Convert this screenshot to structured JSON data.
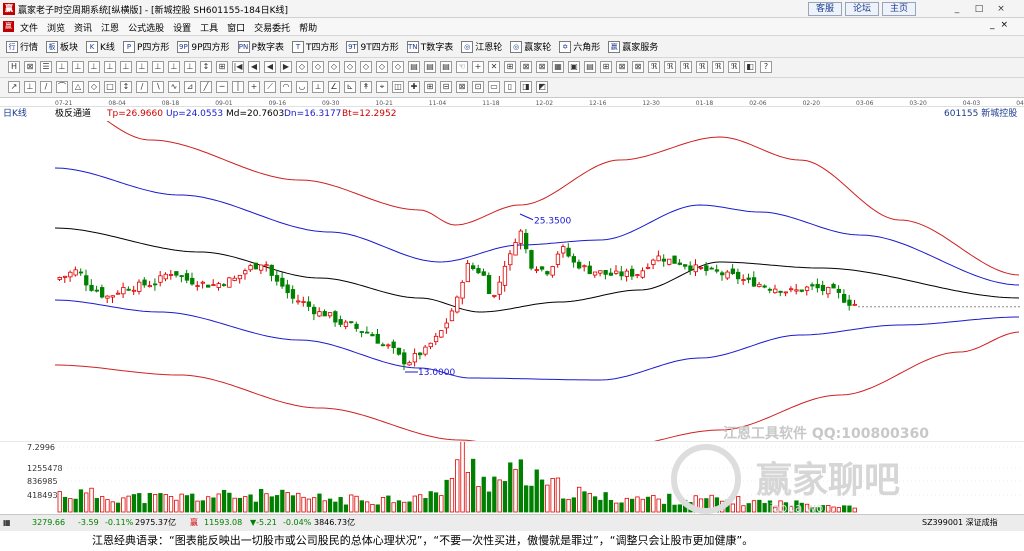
{
  "window": {
    "title": "赢家老子时空周期系统[纵横版] - [新城控股  SH601155-184日K线]",
    "app_icon_text": "赢",
    "link_buttons": [
      "客服",
      "论坛",
      "主页"
    ],
    "controls": [
      "_",
      "□",
      "×"
    ]
  },
  "menu": {
    "icon_text": "赢",
    "items": [
      "文件",
      "浏览",
      "资讯",
      "江恩",
      "公式选股",
      "设置",
      "工具",
      "窗口",
      "交易委托",
      "帮助"
    ],
    "right_controls": [
      "_",
      "×"
    ]
  },
  "toolbar1": {
    "items": [
      {
        "glyph": "行",
        "label": "行情"
      },
      {
        "glyph": "板",
        "label": "板块"
      },
      {
        "glyph": "K",
        "label": "K线"
      },
      {
        "glyph": "P",
        "label": "P四方形"
      },
      {
        "glyph": "9P",
        "label": "9P四方形"
      },
      {
        "glyph": "PN",
        "label": "P数字表"
      },
      {
        "glyph": "T",
        "label": "T四方形"
      },
      {
        "glyph": "9T",
        "label": "9T四方形"
      },
      {
        "glyph": "TN",
        "label": "T数字表"
      },
      {
        "glyph": "◎",
        "label": "江恩轮"
      },
      {
        "glyph": "◎",
        "label": "赢家轮"
      },
      {
        "glyph": "✡",
        "label": "六角形"
      },
      {
        "glyph": "赢",
        "label": "赢家服务"
      }
    ]
  },
  "toolbar2": {
    "icons": [
      "H",
      "⊠",
      "☰",
      "⊥",
      "⊥",
      "⊥",
      "⊥",
      "⊥",
      "⊥",
      "⊥",
      "⊥",
      "⊥",
      "↕",
      "⊞",
      "|◀",
      "◀",
      "◀",
      "▶",
      "◇",
      "◇",
      "◇",
      "◇",
      "◇",
      "◇",
      "◇",
      "▤",
      "▤",
      "▤",
      "☜",
      "+",
      "✕",
      "⊞",
      "⊠",
      "⊠",
      "▦",
      "▣",
      "▤",
      "⊞",
      "⊠",
      "⊠",
      "ℜ",
      "ℜ",
      "ℜ",
      "ℜ",
      "ℜ",
      "ℜ",
      "◧",
      "?"
    ]
  },
  "toolbar3": {
    "icons": [
      "↗",
      "⊥",
      "/",
      "⌒",
      "△",
      "◇",
      "□",
      "↕",
      "∕",
      "∖",
      "∿",
      "⊿",
      "╱",
      "─",
      "│",
      "+",
      "⟋",
      "◠",
      "◡",
      "⟂",
      "∠",
      "⊾",
      "↟",
      "⌖",
      "◫",
      "✚",
      "⊞",
      "⊟",
      "⊠",
      "⊡",
      "▭",
      "▯",
      "◨",
      "◩"
    ]
  },
  "time_axis": {
    "period_label": "日K线",
    "ticks": [
      "07-21",
      "08-04",
      "08-18",
      "09-01",
      "09-16",
      "09-30",
      "10-21",
      "11-04",
      "11-18",
      "12-02",
      "12-16",
      "12-30",
      "01-18",
      "02-06",
      "02-20",
      "03-06",
      "03-20",
      "04-03",
      "04-17"
    ]
  },
  "indicator": {
    "name": "极反通道",
    "tp": "Tp=26.9660",
    "up": "Up=24.0553",
    "md": "Md=20.7603",
    "dn": "Dn=16.3177",
    "bt": "Bt=12.2952",
    "stock": "601155  新城控股"
  },
  "chart_data": {
    "type": "candlestick",
    "colors": {
      "up": "#e00000",
      "down": "#008000",
      "tp_bt": "#d02020",
      "up_dn": "#1a1ad0",
      "md": "#000000"
    },
    "annotations": [
      {
        "label": "25.3500",
        "type": "high"
      },
      {
        "label": "13.0000",
        "type": "low"
      }
    ],
    "volume_ticks": [
      "7.2996",
      "1255478",
      "836985",
      "418493"
    ]
  },
  "statusbar": {
    "sh_index": "3279.66",
    "sh_change": "-3.59",
    "sh_pct": "-0.11%",
    "sh_amount": "2975.37亿",
    "sz_index": "11593.08",
    "sz_change": "▼-5.21",
    "sz_pct": "-0.04%",
    "sz_amount": "3846.73亿",
    "right": "SZ399001 深证成指"
  },
  "quote": {
    "text": "江恩经典语录：“图表能反映出一切股市或公司股民的总体心理状况”，“不要一次性买进，傲慢就是罪过”，“调整只会让股市更加健康”。"
  },
  "watermark": {
    "line1": "江恩工具软件  QQ:100800360",
    "logo": "赢家聊吧",
    "sub": "liaoba.wo..."
  }
}
